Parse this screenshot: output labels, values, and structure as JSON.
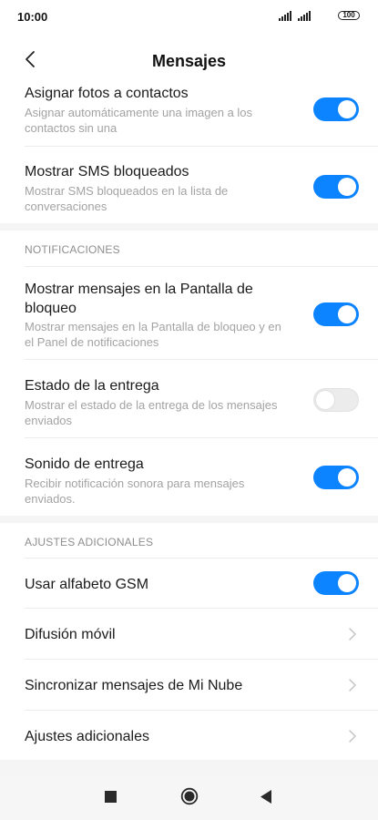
{
  "status_bar": {
    "time": "10:00",
    "battery": "100"
  },
  "header": {
    "title": "Mensajes"
  },
  "rows": {
    "asignar_fotos": {
      "title": "Asignar fotos a contactos",
      "subtitle_1": "Asignar automáticamente una imagen a los",
      "subtitle_2": "contactos sin una",
      "enabled": true
    },
    "sms_bloqueados": {
      "title": "Mostrar SMS bloqueados",
      "subtitle_1": "Mostrar SMS bloqueados en la lista de",
      "subtitle_2": "conversaciones",
      "enabled": true
    },
    "pantalla_bloqueo": {
      "title_1": "Mostrar mensajes en la Pantalla de",
      "title_2": "bloqueo",
      "subtitle_1": "Mostrar mensajes en la Pantalla de bloqueo y en",
      "subtitle_2": "el Panel de notificaciones",
      "enabled": true
    },
    "estado_entrega": {
      "title": "Estado de la entrega",
      "subtitle_1": "Mostrar el estado de la entrega de los mensajes",
      "subtitle_2": "enviados",
      "enabled": false
    },
    "sonido_entrega": {
      "title": "Sonido de entrega",
      "subtitle_1": "Recibir notificación sonora para mensajes",
      "subtitle_2": "enviados.",
      "enabled": true
    },
    "alfabeto_gsm": {
      "title": "Usar alfabeto GSM",
      "enabled": true
    },
    "difusion_movil": {
      "title": "Difusión móvil"
    },
    "sincronizar": {
      "title": "Sincronizar mensajes de Mi Nube"
    },
    "ajustes_adicionales": {
      "title": "Ajustes adicionales"
    }
  },
  "sections": {
    "notificaciones": "NOTIFICACIONES",
    "ajustes_adicionales": "AJUSTES ADICIONALES"
  },
  "colors": {
    "accent": "#0d84ff",
    "toggle_off": "#ececec",
    "secondary_text": "#a3a3a3"
  },
  "icons": {
    "back": "chevron-left-icon",
    "chevron": "chevron-right-icon",
    "nav_recents": "square-icon",
    "nav_home": "circle-icon",
    "nav_back": "triangle-left-icon"
  }
}
